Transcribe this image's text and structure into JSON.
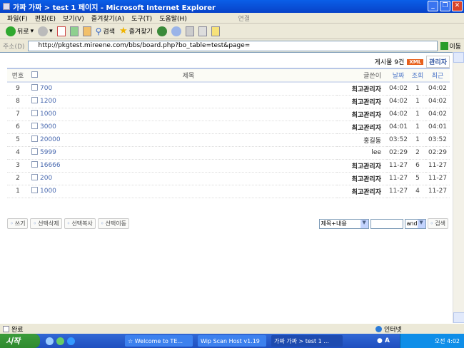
{
  "window": {
    "title": "가짜 가짜 > test 1 페이지 - Microsoft Internet Explorer"
  },
  "menu": [
    "파일(F)",
    "편집(E)",
    "보기(V)",
    "즐겨찾기(A)",
    "도구(T)",
    "도움말(H)"
  ],
  "menu_link": "연결",
  "toolbar": {
    "back": "뒤로",
    "search": "검색",
    "favorites": "즐겨찾기"
  },
  "address": {
    "label": "주소(D)",
    "url": "http://pkgtest.mireene.com/bbs/board.php?bo_table=test&page=",
    "go": "이동"
  },
  "board": {
    "count_text": "게시물 9건",
    "xml": "XML",
    "admin": "관리자",
    "headers": {
      "num": "번호",
      "subject": "제목",
      "writer": "글쓴이",
      "date": "날짜",
      "hits": "조회",
      "recent": "최근"
    },
    "rows": [
      {
        "num": "9",
        "subject": "700",
        "writer": "최고관리자",
        "date": "04:02",
        "hits": "1",
        "recent": "04:02",
        "bold": true
      },
      {
        "num": "8",
        "subject": "1200",
        "writer": "최고관리자",
        "date": "04:02",
        "hits": "1",
        "recent": "04:02",
        "bold": true
      },
      {
        "num": "7",
        "subject": "1000",
        "writer": "최고관리자",
        "date": "04:02",
        "hits": "1",
        "recent": "04:02",
        "bold": true
      },
      {
        "num": "6",
        "subject": "3000",
        "writer": "최고관리자",
        "date": "04:01",
        "hits": "1",
        "recent": "04:01",
        "bold": true
      },
      {
        "num": "5",
        "subject": "20000",
        "writer": "홍길동",
        "date": "03:52",
        "hits": "1",
        "recent": "03:52",
        "bold": false
      },
      {
        "num": "4",
        "subject": "5999",
        "writer": "lee",
        "date": "02:29",
        "hits": "2",
        "recent": "02:29",
        "bold": false
      },
      {
        "num": "3",
        "subject": "16666",
        "writer": "최고관리자",
        "date": "11-27",
        "hits": "6",
        "recent": "11-27",
        "bold": true
      },
      {
        "num": "2",
        "subject": "200",
        "writer": "최고관리자",
        "date": "11-27",
        "hits": "5",
        "recent": "11-27",
        "bold": true
      },
      {
        "num": "1",
        "subject": "1000",
        "writer": "최고관리자",
        "date": "11-27",
        "hits": "4",
        "recent": "11-27",
        "bold": true
      }
    ],
    "buttons": {
      "write": "쓰기",
      "delete": "선택삭제",
      "copy": "선택복사",
      "move": "선택이동"
    },
    "search": {
      "field": "제목+내용",
      "query": "",
      "op": "and",
      "submit": "검색"
    }
  },
  "status": {
    "text": "완료",
    "zone": "인터넷"
  },
  "taskbar": {
    "start": "시작",
    "tasks": [
      "☆ Welcome to TE...",
      "Wip Scan Host v1.19",
      "가짜 가짜 > test 1 ..."
    ],
    "clock": "오전 4:02"
  }
}
